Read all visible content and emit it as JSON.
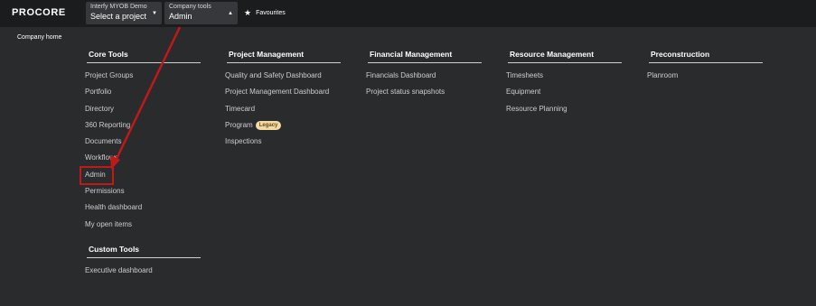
{
  "topbar": {
    "logo": "PROCORE",
    "project_selector": {
      "company": "Interfy MYOB Demo",
      "value": "Select a project"
    },
    "tools_selector": {
      "label": "Company tools",
      "value": "Admin"
    },
    "favourites_label": "Favourites"
  },
  "breadcrumb": "Company home",
  "menu": {
    "core_tools": {
      "title": "Core Tools",
      "items": [
        "Project Groups",
        "Portfolio",
        "Directory",
        "360 Reporting",
        "Documents",
        "Workflows",
        "Admin",
        "Permissions",
        "Health dashboard",
        "My open items"
      ]
    },
    "custom_tools": {
      "title": "Custom Tools",
      "items": [
        "Executive dashboard"
      ]
    },
    "project_management": {
      "title": "Project Management",
      "items": [
        "Quality and Safety Dashboard",
        "Project Management Dashboard",
        "Timecard",
        "Program",
        "Inspections"
      ],
      "program_badge": "Legacy"
    },
    "financial_management": {
      "title": "Financial Management",
      "items": [
        "Financials Dashboard",
        "Project status snapshots"
      ]
    },
    "resource_management": {
      "title": "Resource Management",
      "items": [
        "Timesheets",
        "Equipment",
        "Resource Planning"
      ]
    },
    "preconstruction": {
      "title": "Preconstruction",
      "items": [
        "Planroom"
      ]
    }
  },
  "colors": {
    "annotation": "#c01919",
    "topbar": "#1b1c1e",
    "background": "#2a2b2d",
    "badge": "#f2d9a6"
  },
  "icons": {
    "favourites": "star-icon",
    "dropdown": "caret-icon"
  }
}
